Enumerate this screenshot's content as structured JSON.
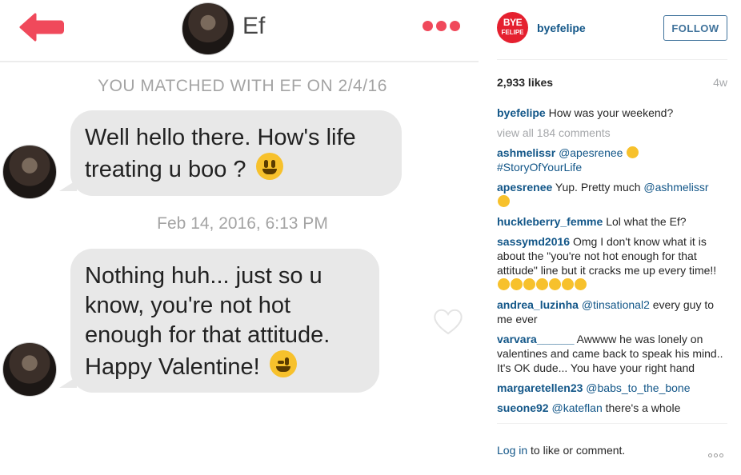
{
  "chat": {
    "contact_name": "Ef",
    "matched_text": "YOU MATCHED WITH EF ON 2/4/16",
    "messages": [
      {
        "text": "Well hello there. How's life treating u boo ?",
        "emoji": "smiley-emoji"
      },
      {
        "text": "Nothing huh... just so u know, you're not hot enough for that attitude. Happy Valentine!",
        "emoji": "wink-emoji"
      }
    ],
    "timestamp": "Feb 14, 2016, 6:13 PM",
    "colors": {
      "accent": "#f0495b",
      "bubble": "#e8e8e8",
      "meta_text": "#a4a4a4"
    }
  },
  "post": {
    "logo": {
      "line1": "BYE",
      "line2": "FELIPE"
    },
    "username": "byefelipe",
    "follow_label": "FOLLOW",
    "likes": "2,933 likes",
    "age": "4w",
    "caption": {
      "user": "byefelipe",
      "text": "How was your weekend?"
    },
    "view_all": "view all 184 comments",
    "comments": [
      {
        "user": "ashmelissr",
        "mention": "@apesrenee",
        "text": "",
        "tag": "#StoryOfYourLife",
        "emoji_count": 1
      },
      {
        "user": "apesrenee",
        "text": "Yup. Pretty much",
        "mention": "@ashmelissr",
        "emoji_count": 1
      },
      {
        "user": "huckleberry_femme",
        "text": "Lol what the Ef?"
      },
      {
        "user": "sassymd2016",
        "text": "Omg I don't know what it is about the \"you're not hot enough for that attitude\" line but it cracks me up every time!!",
        "emoji_count": 7
      },
      {
        "user": "andrea_luzinha",
        "mention": "@tinsational2",
        "text": "every guy to me ever"
      },
      {
        "user": "varvara______",
        "text": "Awwww he was lonely on valentines and came back to speak his mind.. It's OK dude... You have your right hand"
      },
      {
        "user": "margaretellen23",
        "mention": "@babs_to_the_bone",
        "text": ""
      },
      {
        "user": "sueone92",
        "mention": "@kateflan",
        "text": "there's a whole"
      }
    ],
    "footer": {
      "login": "Log in",
      "rest": "to like or comment."
    },
    "colors": {
      "link": "#125688",
      "follow": "#3f729b",
      "logo": "#e5202f",
      "muted": "#a5a7aa"
    }
  }
}
